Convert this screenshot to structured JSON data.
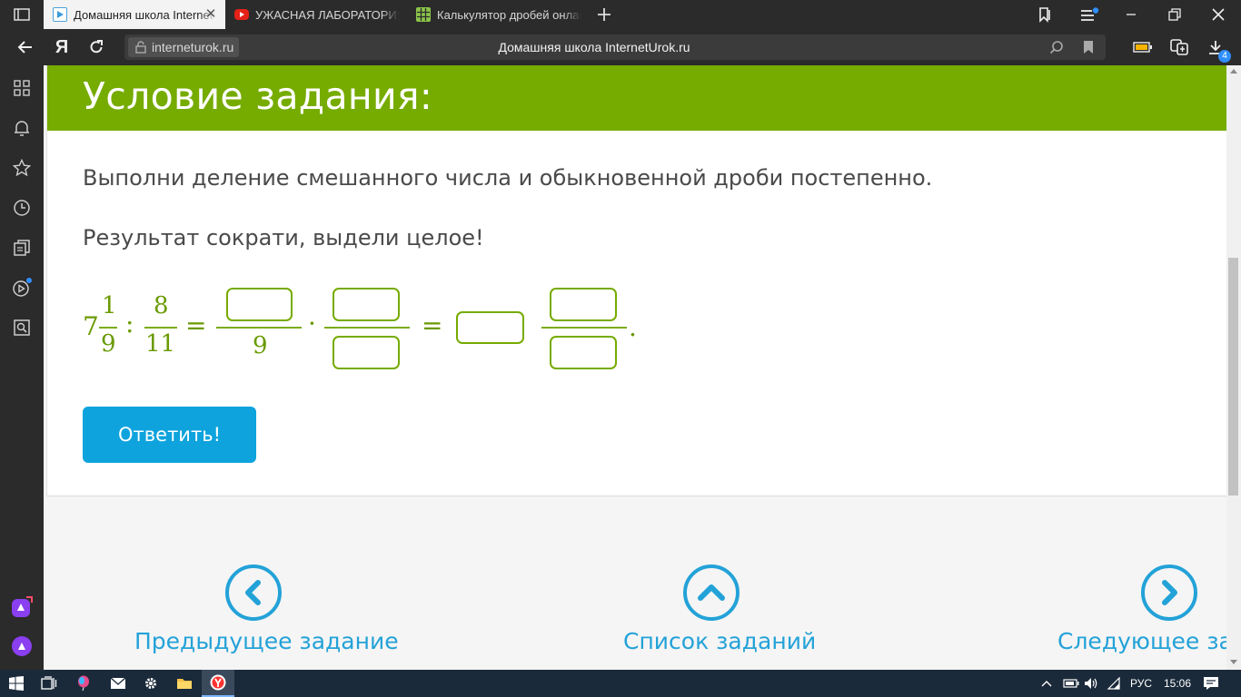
{
  "tabs": [
    {
      "label": "Домашняя школа InternetUrok.ru",
      "active": true
    },
    {
      "label": "УЖАСНАЯ ЛАБОРАТОРИЯ",
      "active": false
    },
    {
      "label": "Калькулятор дробей онлайн",
      "active": false
    }
  ],
  "address": {
    "domain": "interneturok.ru",
    "title": "Домашняя школа InternetUrok.ru",
    "yandex_label": "Я",
    "downloads_badge": "4"
  },
  "task": {
    "heading": "Условие задания:",
    "instruction_1": "Выполни деление смешанного числа и обыкновенной дроби постепенно.",
    "instruction_2": "Результат сократи, выдели целое!",
    "expression": {
      "whole": "7",
      "num1": "1",
      "den1": "9",
      "divide": ":",
      "num2": "8",
      "den2": "11",
      "eq": "=",
      "den3": "9",
      "dot": "·",
      "eq2": "=",
      "period": "."
    },
    "answer_button": "Ответить!"
  },
  "nav": {
    "prev": "Предыдущее задание",
    "list": "Список заданий",
    "next": "Следующее задание"
  },
  "taskbar": {
    "lang": "РУС",
    "time": "15:06"
  },
  "colors": {
    "accent_green": "#76ab00",
    "button_blue": "#0ea3dd",
    "nav_blue": "#23a2d8",
    "chrome_dark": "#2b2b2b"
  }
}
